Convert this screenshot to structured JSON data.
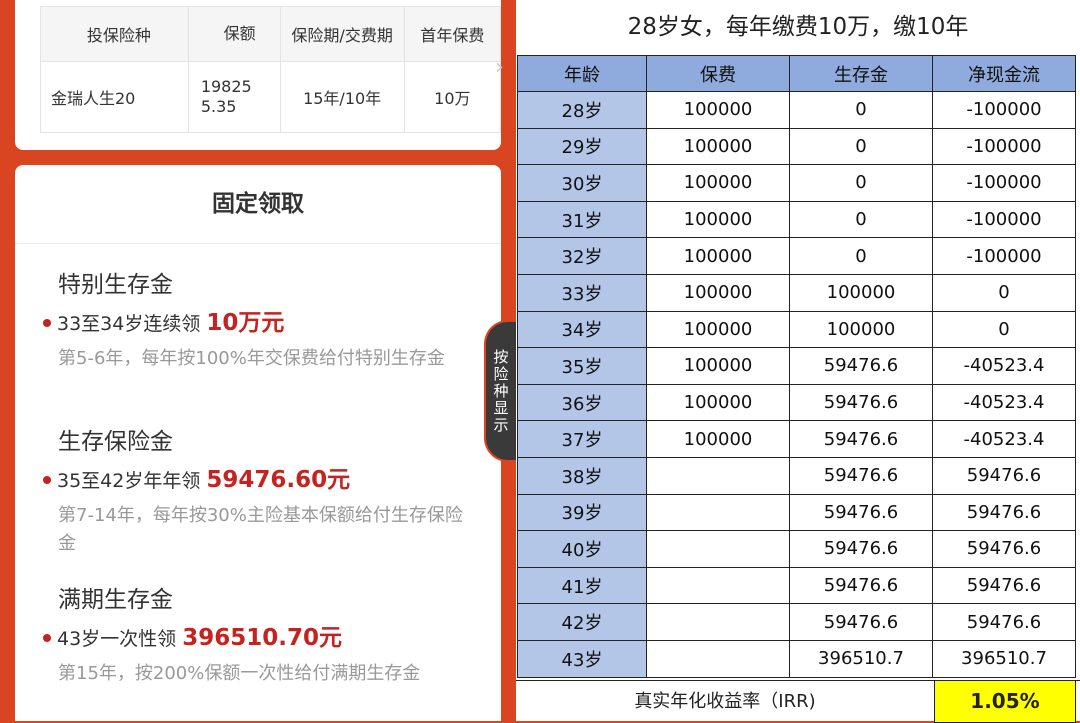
{
  "plan_table": {
    "headers": [
      "投保险种",
      "保额",
      "保险期/交费期",
      "首年保费"
    ],
    "row": {
      "product": "金瑞人生20",
      "amount_l1": "19825",
      "amount_l2": "5.35",
      "term": "15年/10年",
      "premium": "10万"
    }
  },
  "card": {
    "title": "固定领取",
    "items": [
      {
        "title": "特别生存金",
        "line_prefix": "33至34岁连续领",
        "amount": "10万元",
        "desc": "第5-6年，每年按100%年交保费给付特别生存金"
      },
      {
        "title": "生存保险金",
        "line_prefix": "35至42岁年年领",
        "amount": "59476.60元",
        "desc": "第7-14年，每年按30%主险基本保额给付生存保险金"
      },
      {
        "title": "满期生存金",
        "line_prefix": "43岁一次性领",
        "amount": "396510.70元",
        "desc": "第15年，按200%保额一次性给付满期生存金"
      }
    ]
  },
  "side_tab": {
    "label": "按险种显示"
  },
  "cashflow": {
    "title": "28岁女，每年缴费10万，缴10年",
    "headers": [
      "年龄",
      "保费",
      "生存金",
      "净现金流"
    ],
    "rows": [
      [
        "28岁",
        "100000",
        "0",
        "-100000"
      ],
      [
        "29岁",
        "100000",
        "0",
        "-100000"
      ],
      [
        "30岁",
        "100000",
        "0",
        "-100000"
      ],
      [
        "31岁",
        "100000",
        "0",
        "-100000"
      ],
      [
        "32岁",
        "100000",
        "0",
        "-100000"
      ],
      [
        "33岁",
        "100000",
        "100000",
        "0"
      ],
      [
        "34岁",
        "100000",
        "100000",
        "0"
      ],
      [
        "35岁",
        "100000",
        "59476.6",
        "-40523.4"
      ],
      [
        "36岁",
        "100000",
        "59476.6",
        "-40523.4"
      ],
      [
        "37岁",
        "100000",
        "59476.6",
        "-40523.4"
      ],
      [
        "38岁",
        "",
        "59476.6",
        "59476.6"
      ],
      [
        "39岁",
        "",
        "59476.6",
        "59476.6"
      ],
      [
        "40岁",
        "",
        "59476.6",
        "59476.6"
      ],
      [
        "41岁",
        "",
        "59476.6",
        "59476.6"
      ],
      [
        "42岁",
        "",
        "59476.6",
        "59476.6"
      ],
      [
        "43岁",
        "",
        "396510.7",
        "396510.7"
      ]
    ],
    "irr_label": "真实年化收益率（IRR)",
    "irr_value": "1.05%"
  },
  "colors": {
    "brand_red": "#d94521",
    "amount_red": "#c4231f",
    "header_blue": "#8faadc",
    "age_blue": "#b4c6e7",
    "highlight_yellow": "#ffff00"
  }
}
